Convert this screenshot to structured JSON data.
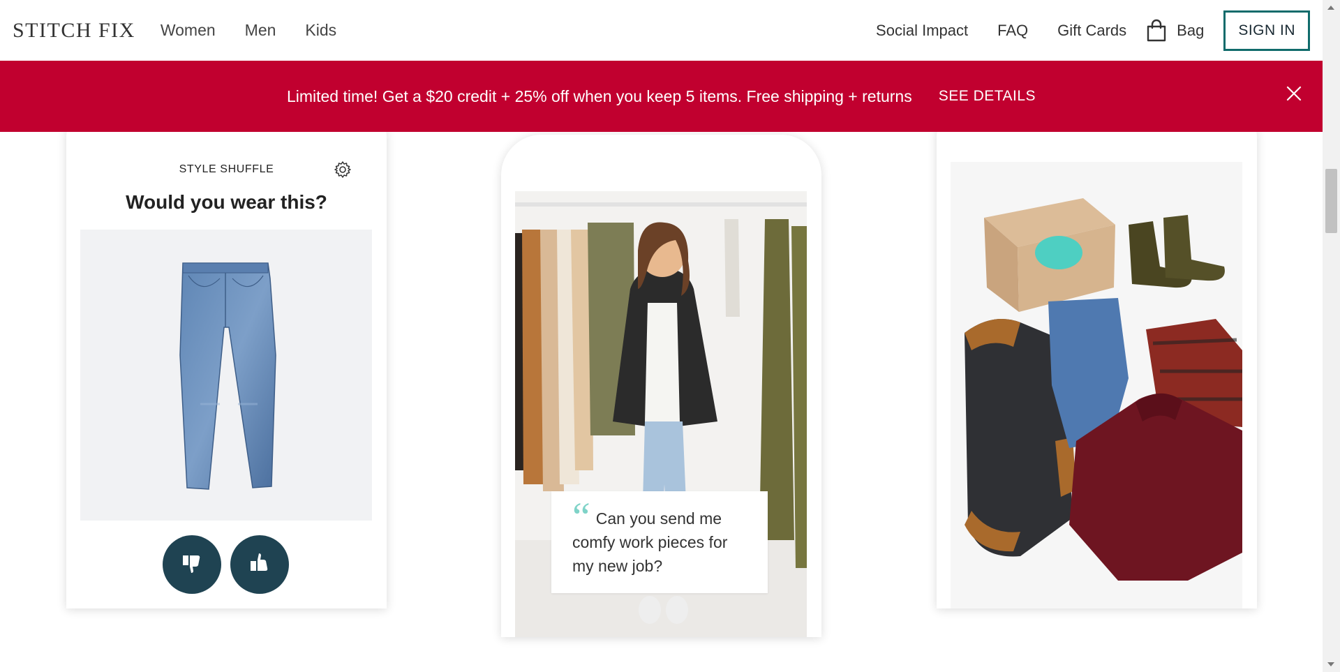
{
  "header": {
    "logo": "STITCH FIX",
    "nav_left": [
      "Women",
      "Men",
      "Kids"
    ],
    "nav_right": [
      "Social Impact",
      "FAQ",
      "Gift Cards"
    ],
    "bag_label": "Bag",
    "sign_in": "SIGN IN"
  },
  "promo": {
    "text": "Limited time! Get a $20 credit + 25% off when you keep 5 items. Free shipping + returns",
    "link": "SEE DETAILS"
  },
  "style_shuffle": {
    "label": "STYLE SHUFFLE",
    "title": "Would you wear this?"
  },
  "quote": {
    "text": "Can you send me comfy work pieces for my new job?"
  },
  "colors": {
    "promo_bg": "#c1002f",
    "vote_button": "#1f4352",
    "quote_mark": "#7fd3c8",
    "signin_border": "#106b6b"
  },
  "icons": {
    "bag": "shopping-bag-icon",
    "close": "close-icon",
    "settings": "gear-icon",
    "dislike": "thumbs-down-icon",
    "like": "thumbs-up-icon"
  }
}
